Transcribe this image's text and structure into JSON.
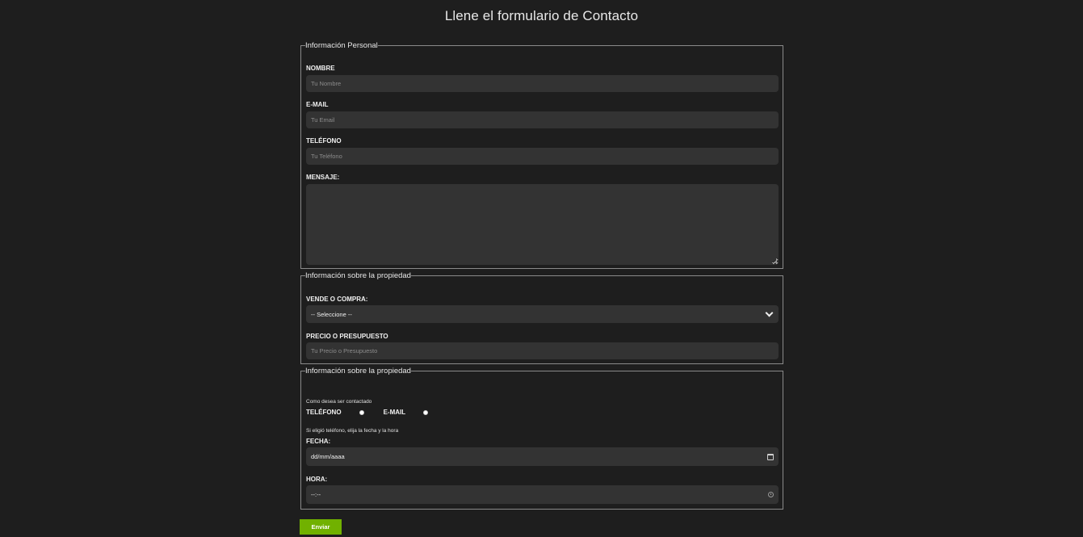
{
  "page": {
    "title": "Llene el formulario de Contacto"
  },
  "personal": {
    "legend": "Información Personal",
    "nombre_label": "NOMBRE",
    "nombre_placeholder": "Tu Nombre",
    "email_label": "E-MAIL",
    "email_placeholder": "Tu Email",
    "telefono_label": "TELÉFONO",
    "telefono_placeholder": "Tu Teléfono",
    "mensaje_label": "MENSAJE:"
  },
  "propiedad": {
    "legend": "Información sobre la propiedad",
    "tipo_label": "VENDE O COMPRA:",
    "tipo_selected": "-- Seleccione --",
    "precio_label": "PRECIO O PRESUPUESTO",
    "precio_placeholder": "Tu Precio o Presupuesto"
  },
  "contacto": {
    "legend": "Información sobre la propiedad",
    "intro": "Como desea ser contactado",
    "opcion_telefono": "TELÉFONO",
    "opcion_email": "E-MAIL",
    "nota": "Si eligió teléfono, elija la fecha y la hora",
    "fecha_label": "FECHA:",
    "fecha_value": "dd/mm/aaaa",
    "hora_label": "HORA:",
    "hora_value": "--:--"
  },
  "actions": {
    "submit_label": "Enviar"
  },
  "colors": {
    "background": "#1e1e1e",
    "field": "#333333",
    "accent": "#71b100"
  },
  "icons": {
    "select": "chevron-down-icon",
    "date": "calendar-icon",
    "time": "clock-icon"
  }
}
